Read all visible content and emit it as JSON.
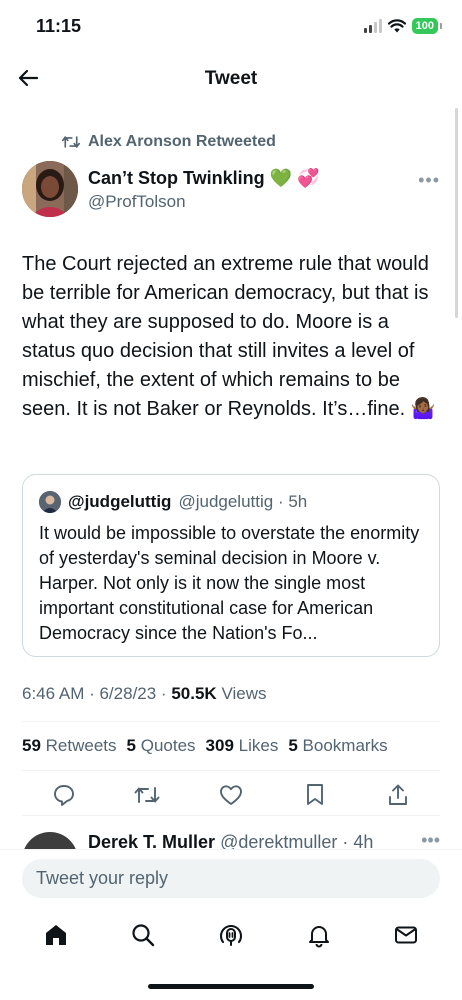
{
  "status_bar": {
    "time": "11:15",
    "battery": "100"
  },
  "header": {
    "title": "Tweet"
  },
  "tweet": {
    "retweeted_by": "Alex Aronson Retweeted",
    "author_name": "Can’t Stop Twinkling 💚 💞",
    "author_handle": "@ProfTolson",
    "text": "The Court rejected an extreme rule that would be terrible for American democracy, but that is what they are supposed to do. Moore is a status quo decision that still invites a level of mischief, the extent of which remains to be seen.  It is not Baker or Reynolds. It’s…fine. 🤷🏾‍♀️",
    "quote": {
      "name": "@judgeluttig",
      "meta": "@judgeluttig · 5h",
      "text": "It would be impossible to overstate the enormity of yesterday's seminal decision in Moore v. Harper.  Not only is it now the single most important constitutional case for American Democracy since the Nation's Fo..."
    },
    "time_date": "6:46 AM · 6/28/23 ·",
    "views_count": "50.5K",
    "views_label": "Views",
    "stats": [
      {
        "count": "59",
        "label": "Retweets"
      },
      {
        "count": "5",
        "label": "Quotes"
      },
      {
        "count": "309",
        "label": "Likes"
      },
      {
        "count": "5",
        "label": "Bookmarks"
      }
    ]
  },
  "reply_preview": {
    "name": "Derek T. Muller",
    "meta": "@derektmuller · 4h"
  },
  "composer": {
    "placeholder": "Tweet your reply"
  },
  "icons": {
    "back": "arrow-left-icon",
    "retweet": "retweet-icon",
    "reply": "reply-icon",
    "like": "heart-icon",
    "bookmark": "bookmark-icon",
    "share": "share-icon",
    "home": "home-icon",
    "search": "search-icon",
    "spaces": "spaces-icon",
    "notifications": "bell-icon",
    "messages": "mail-icon"
  },
  "colors": {
    "battery": "#34c759",
    "text": "#0f1419",
    "secondary": "#536471"
  }
}
